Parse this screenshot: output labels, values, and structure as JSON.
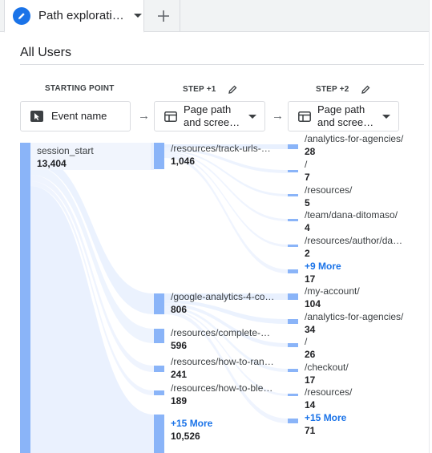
{
  "tab": {
    "label": "Path explorati…",
    "add_label": "+"
  },
  "segment": "All Users",
  "columns": [
    {
      "header": "STARTING POINT",
      "selector": [
        "Event name"
      ]
    },
    {
      "header": "STEP +1",
      "selector": [
        "Page path",
        "and scree…"
      ]
    },
    {
      "header": "STEP +2",
      "selector": [
        "Page path",
        "and scree…"
      ]
    }
  ],
  "start_node": {
    "label": "session_start",
    "value": "13,404"
  },
  "step1_nodes": [
    {
      "label": "/resources/track-urls-…",
      "value": "1,046"
    },
    {
      "label": "/google-analytics-4-co…",
      "value": "806"
    },
    {
      "label": "/resources/complete-…",
      "value": "596"
    },
    {
      "label": "/resources/how-to-ran…",
      "value": "241"
    },
    {
      "label": "/resources/how-to-ble…",
      "value": "189"
    }
  ],
  "step1_more": {
    "label": "+15 More",
    "value": "10,526"
  },
  "step2_nodes_a": [
    {
      "label": "/analytics-for-agencies/",
      "value": "28"
    },
    {
      "label": "/",
      "value": "7"
    },
    {
      "label": "/resources/",
      "value": "5"
    },
    {
      "label": "/team/dana-ditomaso/",
      "value": "4"
    },
    {
      "label": "/resources/author/da…",
      "value": "2"
    }
  ],
  "step2_more_a": {
    "label": "+9 More",
    "value": "17"
  },
  "step2_nodes_b": [
    {
      "label": "/my-account/",
      "value": "104"
    },
    {
      "label": "/analytics-for-agencies/",
      "value": "34"
    },
    {
      "label": "/",
      "value": "26"
    },
    {
      "label": "/checkout/",
      "value": "17"
    },
    {
      "label": "/resources/",
      "value": "14"
    }
  ],
  "step2_more_b": {
    "label": "+15 More",
    "value": "71"
  },
  "colors": {
    "node": "#8ab4f8",
    "flow": "#e8f0fe",
    "accent": "#1a73e8"
  }
}
